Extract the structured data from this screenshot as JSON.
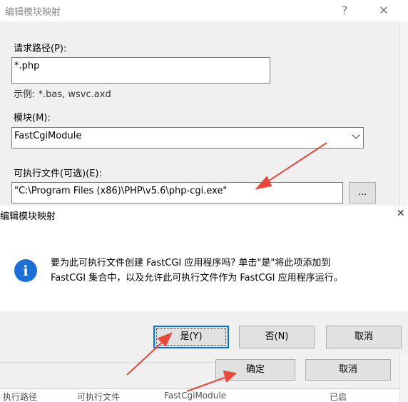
{
  "under_dialog": {
    "title": "编辑模块映射",
    "help_glyph": "?",
    "close_glyph": "✕",
    "request_path": {
      "label": "请求路径(P):",
      "value": "*.php",
      "hint": "示例: *.bas, wsvc.axd"
    },
    "module": {
      "label": "模块(M):",
      "value": "FastCgiModule"
    },
    "executable": {
      "label": "可执行文件(可选)(E):",
      "value": "\"C:\\Program Files (x86)\\PHP\\v5.6\\php-cgi.exe\"",
      "browse_label": "..."
    }
  },
  "confirm_dialog": {
    "title": "编辑模块映射",
    "close_glyph": "✕",
    "icon_glyph": "i",
    "message_line1": "要为此可执行文件创建 FastCGI 应用程序吗? 单击\"是\"将此项添加到",
    "message_line2": "FastCGI 集合中，以及允许此可执行文件作为 FastCGI 应用程序运行。",
    "buttons": {
      "yes": "是(Y)",
      "no": "否(N)",
      "cancel": "取消"
    }
  },
  "under_footer": {
    "ok": "确定",
    "cancel": "取消",
    "peek": [
      "执行路径",
      "可执行文件",
      "FastCgiModule",
      "已启"
    ]
  },
  "colors": {
    "annotation_arrow": "#e8483b",
    "accent": "#0078d7",
    "info_icon": "#1d6fd6"
  }
}
